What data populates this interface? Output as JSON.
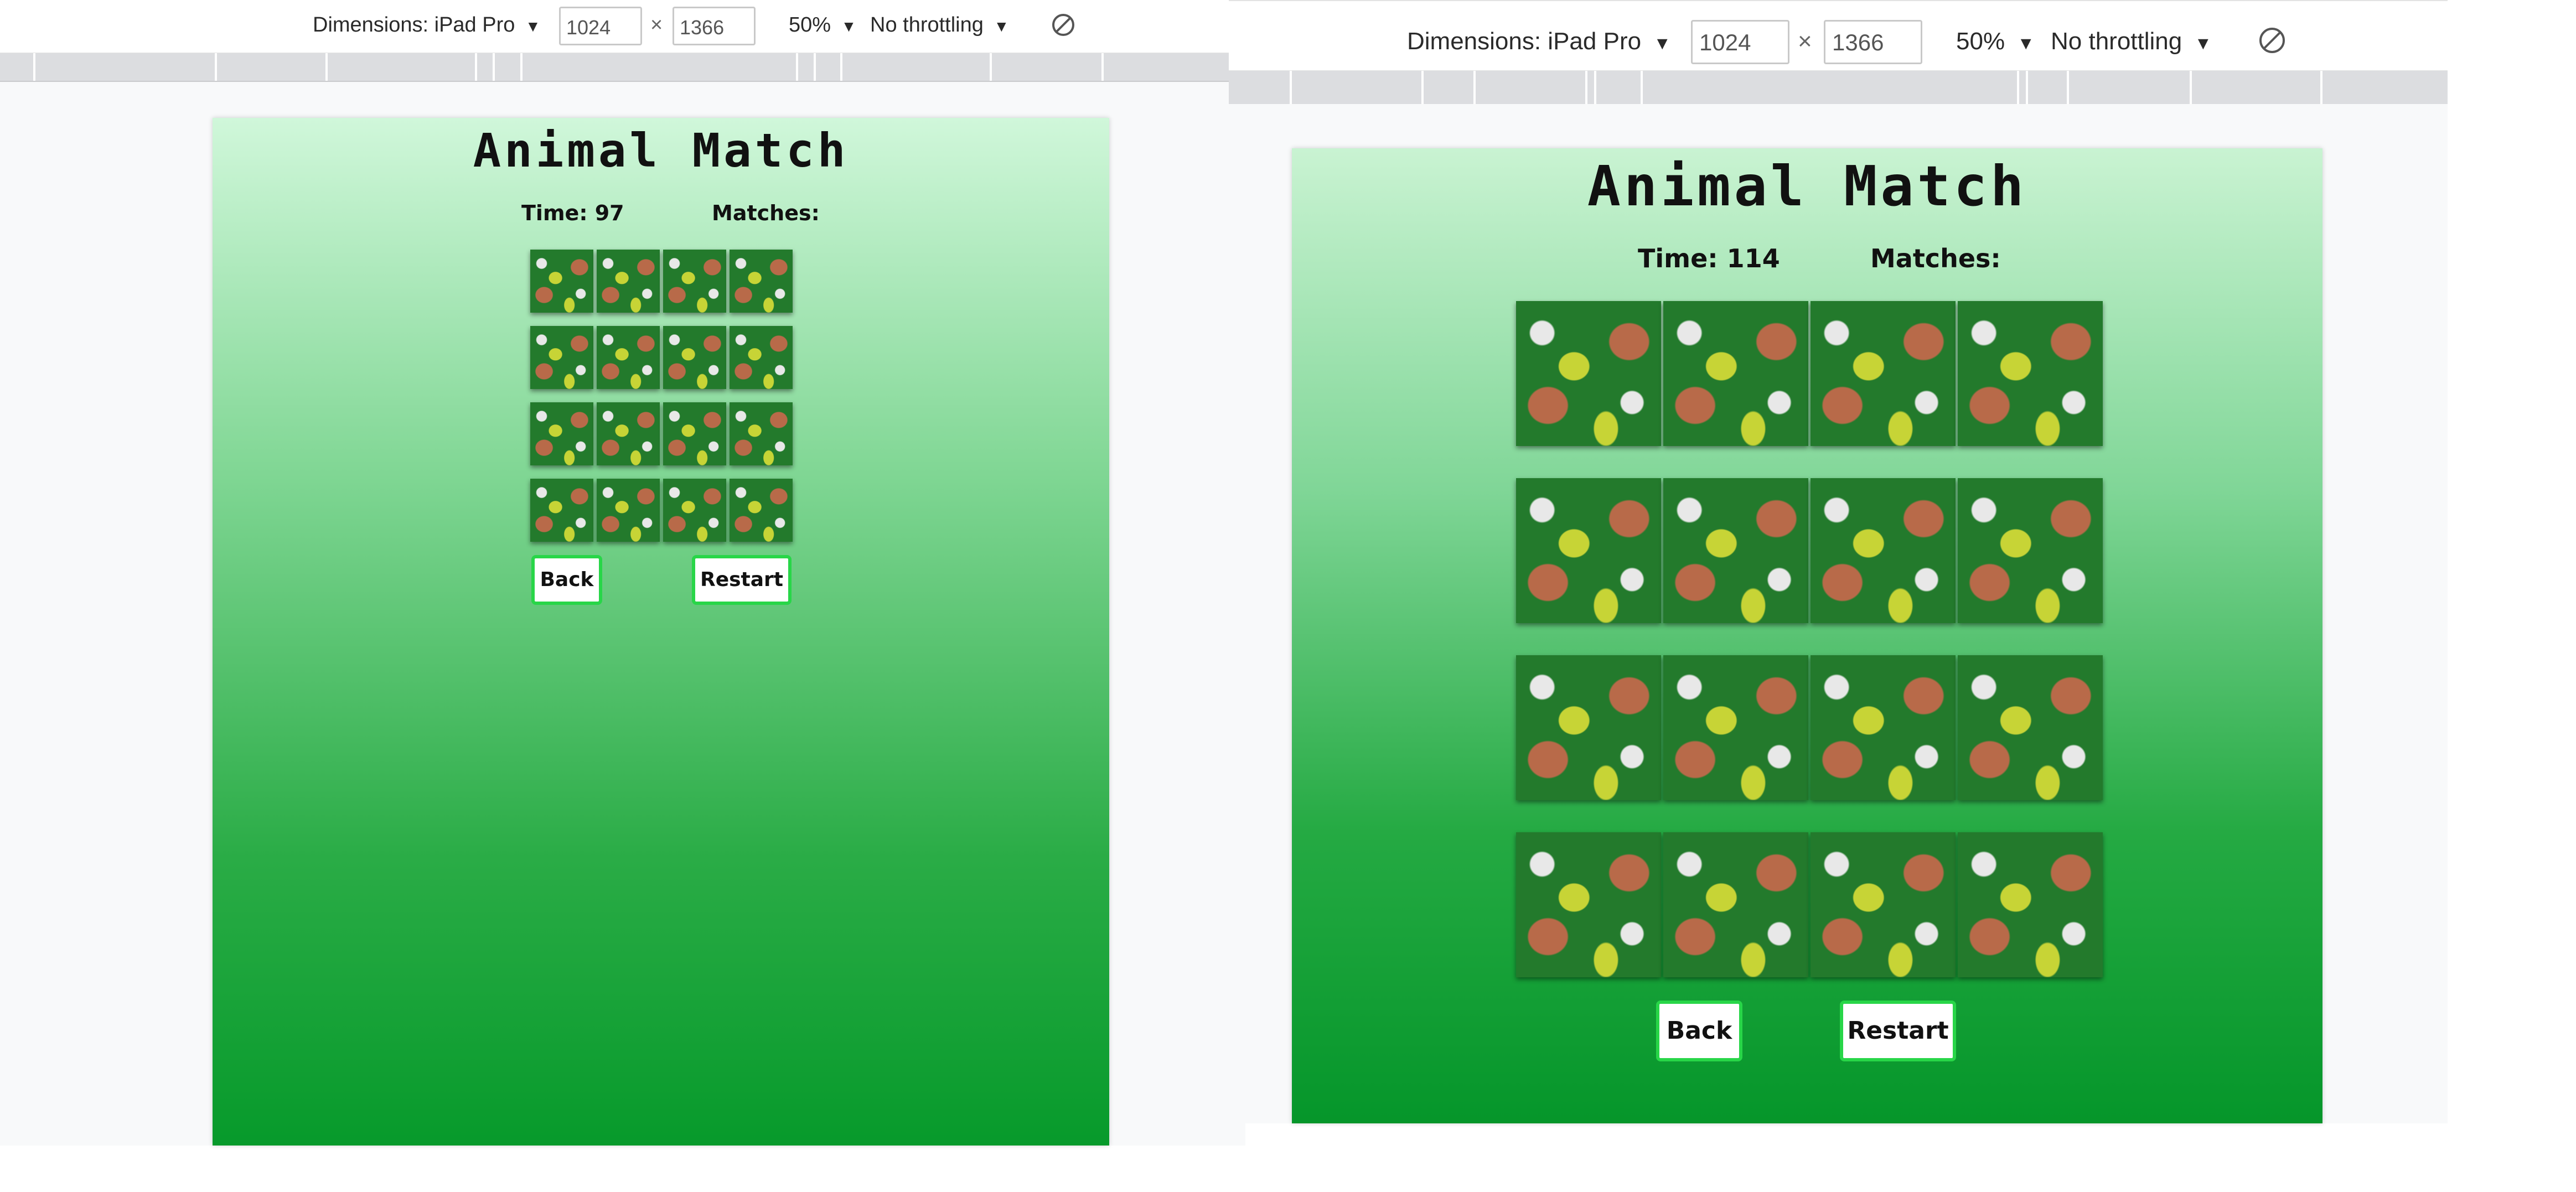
{
  "left": {
    "toolbar": {
      "dimensions_label": "Dimensions: iPad Pro",
      "width_value": "1024",
      "times": "×",
      "height_value": "1366",
      "zoom": "50%",
      "throttling": "No throttling",
      "rotate_icon": "rotate-disabled-icon",
      "caret": "▼"
    },
    "game": {
      "title": "Animal Match",
      "time_label": "Time: 97",
      "matches_label": "Matches:",
      "back_label": "Back",
      "restart_label": "Restart"
    }
  },
  "right": {
    "toolbar": {
      "dimensions_label": "Dimensions: iPad Pro",
      "width_value": "1024",
      "times": "×",
      "height_value": "1366",
      "zoom": "50%",
      "throttling": "No throttling",
      "rotate_icon": "rotate-disabled-icon",
      "caret": "▼"
    },
    "game": {
      "title": "Animal Match",
      "time_label": "Time: 114",
      "matches_label": "Matches:",
      "back_label": "Back",
      "restart_label": "Restart"
    }
  },
  "colors": {
    "card_back": "#237a2c",
    "button_border": "#28d648",
    "gradient_top": "#d0f7da",
    "gradient_bottom": "#079a2b"
  }
}
